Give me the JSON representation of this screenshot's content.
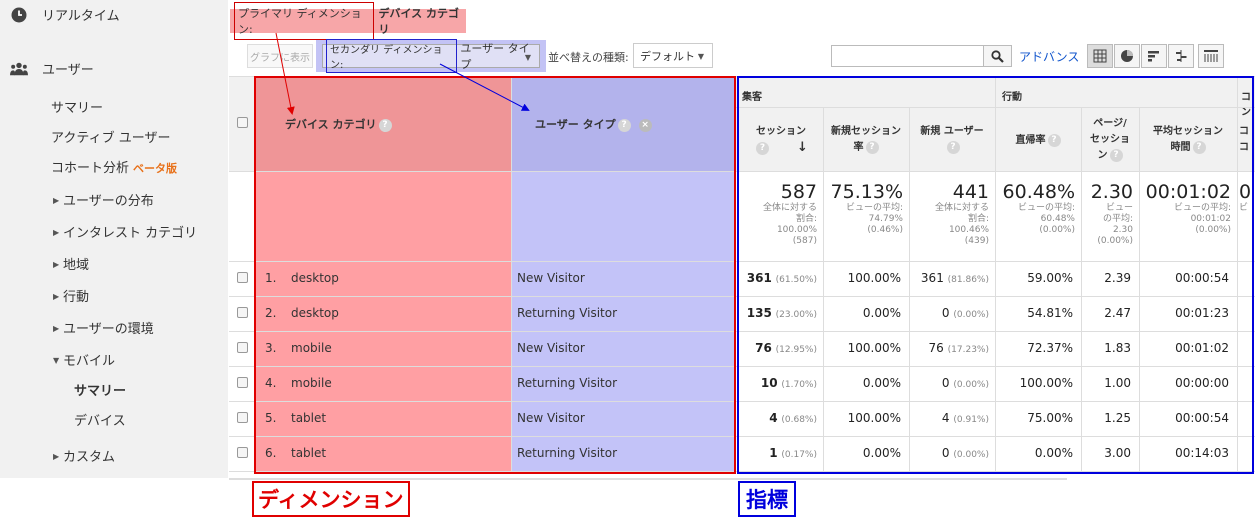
{
  "sidebar": {
    "realtime": "リアルタイム",
    "users": "ユーザー",
    "summary": "サマリー",
    "active_users": "アクティブ ユーザー",
    "cohort": "コホート分析",
    "beta": "ベータ版",
    "user_distribution": "ユーザーの分布",
    "interest_category": "インタレスト カテゴリ",
    "region": "地域",
    "behavior": "行動",
    "user_environment": "ユーザーの環境",
    "mobile": "モバイル",
    "mobile_summary": "サマリー",
    "devices": "デバイス",
    "custom": "カスタム"
  },
  "primary_dimension": {
    "label": "プライマリ ディメンション:",
    "value": "デバイス カテゴリ"
  },
  "toolbar": {
    "graph_button": "グラフに表示",
    "secondary_label": "セカンダリ ディメンション:",
    "secondary_value": "ユーザー タイプ",
    "sort_label": "並べ替えの種類:",
    "sort_value": "デフォルト",
    "search_placeholder": "",
    "advanced": "アドバンス"
  },
  "table": {
    "dim1_header": "デバイス カテゴリ",
    "dim2_header": "ユーザー タイプ",
    "group_acquisition": "集客",
    "group_behavior": "行動",
    "group_conversion": "コン",
    "metric_headers": [
      {
        "line1": "セッション",
        "line2": ""
      },
      {
        "line1": "新規セッション",
        "line2": "率"
      },
      {
        "line1": "新規 ユーザー",
        "line2": ""
      },
      {
        "line1": "直帰率",
        "line2": ""
      },
      {
        "line1": "ページ/",
        "line2": "セッショ",
        "line3": "ン"
      },
      {
        "line1": "平均セッション",
        "line2": "時間"
      },
      {
        "line1": "コ",
        "line2": "コ"
      }
    ],
    "totals": [
      {
        "big": "587",
        "s1": "全体に対する",
        "s2": "割合:",
        "s3": "100.00%",
        "s4": "(587)"
      },
      {
        "big": "75.13%",
        "s1": "ビューの平均:",
        "s2": "74.79%",
        "s3": "(0.46%)",
        "s4": ""
      },
      {
        "big": "441",
        "s1": "全体に対する",
        "s2": "割合:",
        "s3": "100.46%",
        "s4": "(439)"
      },
      {
        "big": "60.48%",
        "s1": "ビューの平均:",
        "s2": "60.48%",
        "s3": "(0.00%)",
        "s4": ""
      },
      {
        "big": "2.30",
        "s1": "ビュー",
        "s2": "の平均:",
        "s3": "2.30",
        "s4": "(0.00%)"
      },
      {
        "big": "00:01:02",
        "s1": "ビューの平均:",
        "s2": "00:01:02",
        "s3": "(0.00%)",
        "s4": ""
      },
      {
        "big": "0",
        "s1": "ビ",
        "s2": "",
        "s3": "",
        "s4": ""
      }
    ],
    "rows": [
      {
        "idx": "1.",
        "device": "desktop",
        "type": "New Visitor",
        "sessions": "361",
        "sessions_pct": "(61.50%)",
        "new_rate": "100.00%",
        "new_users": "361",
        "new_users_pct": "(81.86%)",
        "bounce": "59.00%",
        "pages": "2.39",
        "duration": "00:00:54"
      },
      {
        "idx": "2.",
        "device": "desktop",
        "type": "Returning Visitor",
        "sessions": "135",
        "sessions_pct": "(23.00%)",
        "new_rate": "0.00%",
        "new_users": "0",
        "new_users_pct": "(0.00%)",
        "bounce": "54.81%",
        "pages": "2.47",
        "duration": "00:01:23"
      },
      {
        "idx": "3.",
        "device": "mobile",
        "type": "New Visitor",
        "sessions": "76",
        "sessions_pct": "(12.95%)",
        "new_rate": "100.00%",
        "new_users": "76",
        "new_users_pct": "(17.23%)",
        "bounce": "72.37%",
        "pages": "1.83",
        "duration": "00:01:02"
      },
      {
        "idx": "4.",
        "device": "mobile",
        "type": "Returning Visitor",
        "sessions": "10",
        "sessions_pct": "(1.70%)",
        "new_rate": "0.00%",
        "new_users": "0",
        "new_users_pct": "(0.00%)",
        "bounce": "100.00%",
        "pages": "1.00",
        "duration": "00:00:00"
      },
      {
        "idx": "5.",
        "device": "tablet",
        "type": "New Visitor",
        "sessions": "4",
        "sessions_pct": "(0.68%)",
        "new_rate": "100.00%",
        "new_users": "4",
        "new_users_pct": "(0.91%)",
        "bounce": "75.00%",
        "pages": "1.25",
        "duration": "00:00:54"
      },
      {
        "idx": "6.",
        "device": "tablet",
        "type": "Returning Visitor",
        "sessions": "1",
        "sessions_pct": "(0.17%)",
        "new_rate": "0.00%",
        "new_users": "0",
        "new_users_pct": "(0.00%)",
        "bounce": "0.00%",
        "pages": "3.00",
        "duration": "00:14:03"
      }
    ]
  },
  "captions": {
    "dimension": "ディメンション",
    "metric": "指標"
  },
  "colors": {
    "dimension_fill": "#ff9fa3",
    "secondary_fill": "#c3c3f8",
    "red": "#e00000",
    "blue": "#0000dd",
    "link": "#1155cc"
  }
}
